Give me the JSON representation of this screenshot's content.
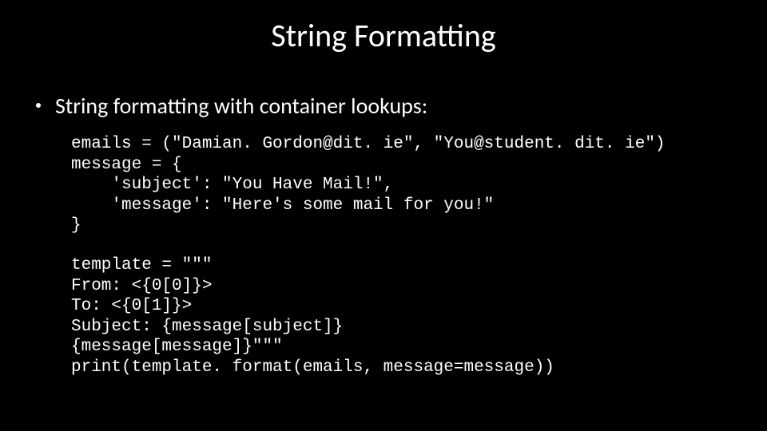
{
  "title": "String Formatting",
  "bullet": "String formatting with container lookups:",
  "code1": "emails = (\"Damian. Gordon@dit. ie\", \"You@student. dit. ie\")\nmessage = {\n    'subject': \"You Have Mail!\",\n    'message': \"Here's some mail for you!\"\n}",
  "code2": "template = \"\"\"\nFrom: <{0[0]}>\nTo: <{0[1]}>\nSubject: {message[subject]}\n{message[message]}\"\"\"\nprint(template. format(emails, message=message))"
}
